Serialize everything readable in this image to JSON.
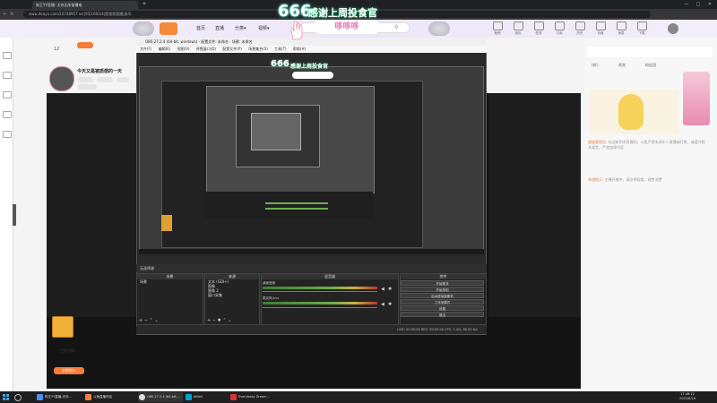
{
  "browser": {
    "tab_title": "狗王YY直播: 天你无所接播电",
    "new_tab": "+",
    "address": "www.douyu.com/10748957   ssr|93|1693(4|是视频直播|接4)",
    "window_controls": [
      "—",
      "□",
      "✕"
    ]
  },
  "site": {
    "nav": [
      "首页",
      "直播",
      "分类▾",
      "视频▾"
    ],
    "header_icons": [
      "鱼吧",
      "钱包",
      "任务",
      "订阅",
      "历史",
      "充值",
      "消息",
      "下载"
    ],
    "follow_count": "12"
  },
  "streamer": {
    "title": "今天又是被质感的一天",
    "tags": [
      "",
      "",
      "",
      ""
    ]
  },
  "overlay": {
    "number": "666",
    "text": "感谢上周投食官",
    "bubble": "哆哆哆"
  },
  "obs": {
    "title": "OBS 27.2.4 (64-bit, windows) - 配置文件: 未命名 - 场景: 未命名",
    "menu": [
      "文件(F)",
      "编辑(E)",
      "视图(V)",
      "停靠窗口(D)",
      "配置文件(P)",
      "场景集合(S)",
      "工具(T)",
      "帮助(H)"
    ],
    "control_row": "无选择源",
    "docks": {
      "scenes": {
        "title": "场景",
        "items": [
          "场景"
        ]
      },
      "sources": {
        "title": "来源",
        "items": [
          "文本 (GDI+)",
          "图像",
          "图像 2",
          "窗口采集"
        ]
      },
      "mixer": {
        "title": "混音器",
        "tracks": [
          "桌面音频",
          "麦克风/Aux"
        ]
      },
      "controls": {
        "title": "控件",
        "buttons": [
          "开始推流",
          "开始录制",
          "启动虚拟摄像机",
          "工作室模式",
          "设置",
          "退出"
        ]
      }
    },
    "status": "LIVE: 00:00:00   REC: 00:00:00   CPU: 1.4%, 60.00 fps"
  },
  "right_panel": {
    "tabs": [
      "排行",
      "贵宾",
      "粉丝团"
    ],
    "chat": [
      {
        "name": "超级管理员:",
        "text": "欢迎来到本直播间，斗鱼严禁未成年人直播或打赏，请遵守相关规定，严禁违规内容"
      },
      {
        "name": "系统提示:",
        "text": "主播开播中，请文明观看，理性消费"
      }
    ]
  },
  "gift": {
    "label": "主播勋章2",
    "button": "立即加入"
  },
  "taskbar": {
    "items": [
      "狗王YY直播-天你...",
      "斗鱼直播伴侣",
      "OBS 27.2.4 (64-bit,...",
      "bilibili",
      "Everybody Dream..."
    ],
    "time": "17:46:12",
    "date": "2022/6/16"
  }
}
